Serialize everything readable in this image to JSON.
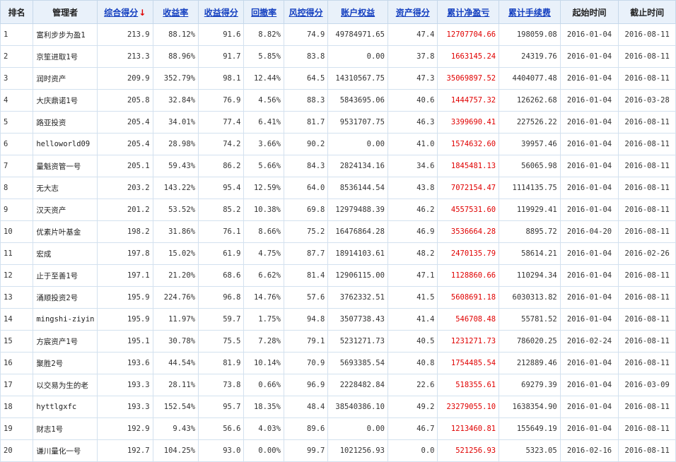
{
  "header": {
    "rank": "排名",
    "manager": "管理者",
    "composite_score": "综合得分",
    "sort_arrow": "↓",
    "return_rate": "收益率",
    "return_score": "收益得分",
    "drawdown": "回撤率",
    "risk_score": "风控得分",
    "equity": "账户权益",
    "asset_score": "资产得分",
    "net_pnl": "累计净盈亏",
    "fees": "累计手续费",
    "start_time": "起始时间",
    "end_time": "截止时间"
  },
  "rows": [
    {
      "rank": "1",
      "name": "富利步步为盈1",
      "score": "213.9",
      "ret": "88.12%",
      "ret_score": "91.6",
      "dd": "8.82%",
      "risk": "74.9",
      "equity": "49784971.65",
      "asset": "47.4",
      "pnl": "12707704.66",
      "fee": "198059.08",
      "start": "2016-01-04",
      "end": "2016-08-11"
    },
    {
      "rank": "2",
      "name": "京笙进取1号",
      "score": "213.3",
      "ret": "88.96%",
      "ret_score": "91.7",
      "dd": "5.85%",
      "risk": "83.8",
      "equity": "0.00",
      "asset": "37.8",
      "pnl": "1663145.24",
      "fee": "24319.76",
      "start": "2016-01-04",
      "end": "2016-08-11"
    },
    {
      "rank": "3",
      "name": "润时资产",
      "score": "209.9",
      "ret": "352.79%",
      "ret_score": "98.1",
      "dd": "12.44%",
      "risk": "64.5",
      "equity": "14310567.75",
      "asset": "47.3",
      "pnl": "35069897.52",
      "fee": "4404077.48",
      "start": "2016-01-04",
      "end": "2016-08-11"
    },
    {
      "rank": "4",
      "name": "大庆鼎诺1号",
      "score": "205.8",
      "ret": "32.84%",
      "ret_score": "76.9",
      "dd": "4.56%",
      "risk": "88.3",
      "equity": "5843695.06",
      "asset": "40.6",
      "pnl": "1444757.32",
      "fee": "126262.68",
      "start": "2016-01-04",
      "end": "2016-03-28"
    },
    {
      "rank": "5",
      "name": "路亚投资",
      "score": "205.4",
      "ret": "34.01%",
      "ret_score": "77.4",
      "dd": "6.41%",
      "risk": "81.7",
      "equity": "9531707.75",
      "asset": "46.3",
      "pnl": "3399690.41",
      "fee": "227526.22",
      "start": "2016-01-04",
      "end": "2016-08-11"
    },
    {
      "rank": "6",
      "name": "helloworld09",
      "score": "205.4",
      "ret": "28.98%",
      "ret_score": "74.2",
      "dd": "3.66%",
      "risk": "90.2",
      "equity": "0.00",
      "asset": "41.0",
      "pnl": "1574632.60",
      "fee": "39957.46",
      "start": "2016-01-04",
      "end": "2016-08-11"
    },
    {
      "rank": "7",
      "name": "量魁资管一号",
      "score": "205.1",
      "ret": "59.43%",
      "ret_score": "86.2",
      "dd": "5.66%",
      "risk": "84.3",
      "equity": "2824134.16",
      "asset": "34.6",
      "pnl": "1845481.13",
      "fee": "56065.98",
      "start": "2016-01-04",
      "end": "2016-08-11"
    },
    {
      "rank": "8",
      "name": "无大志",
      "score": "203.2",
      "ret": "143.22%",
      "ret_score": "95.4",
      "dd": "12.59%",
      "risk": "64.0",
      "equity": "8536144.54",
      "asset": "43.8",
      "pnl": "7072154.47",
      "fee": "1114135.75",
      "start": "2016-01-04",
      "end": "2016-08-11"
    },
    {
      "rank": "9",
      "name": "汉天资产",
      "score": "201.2",
      "ret": "53.52%",
      "ret_score": "85.2",
      "dd": "10.38%",
      "risk": "69.8",
      "equity": "12979488.39",
      "asset": "46.2",
      "pnl": "4557531.60",
      "fee": "119929.41",
      "start": "2016-01-04",
      "end": "2016-08-11"
    },
    {
      "rank": "10",
      "name": "优素片叶基金",
      "score": "198.2",
      "ret": "31.86%",
      "ret_score": "76.1",
      "dd": "8.66%",
      "risk": "75.2",
      "equity": "16476864.28",
      "asset": "46.9",
      "pnl": "3536664.28",
      "fee": "8895.72",
      "start": "2016-04-20",
      "end": "2016-08-11"
    },
    {
      "rank": "11",
      "name": "宏成",
      "score": "197.8",
      "ret": "15.02%",
      "ret_score": "61.9",
      "dd": "4.75%",
      "risk": "87.7",
      "equity": "18914103.61",
      "asset": "48.2",
      "pnl": "2470135.79",
      "fee": "58614.21",
      "start": "2016-01-04",
      "end": "2016-02-26"
    },
    {
      "rank": "12",
      "name": "止于至善1号",
      "score": "197.1",
      "ret": "21.20%",
      "ret_score": "68.6",
      "dd": "6.62%",
      "risk": "81.4",
      "equity": "12906115.00",
      "asset": "47.1",
      "pnl": "1128860.66",
      "fee": "110294.34",
      "start": "2016-01-04",
      "end": "2016-08-11"
    },
    {
      "rank": "13",
      "name": "涌顺投资2号",
      "score": "195.9",
      "ret": "224.76%",
      "ret_score": "96.8",
      "dd": "14.76%",
      "risk": "57.6",
      "equity": "3762332.51",
      "asset": "41.5",
      "pnl": "5608691.18",
      "fee": "6030313.82",
      "start": "2016-01-04",
      "end": "2016-08-11"
    },
    {
      "rank": "14",
      "name": "mingshi-ziyin",
      "score": "195.9",
      "ret": "11.97%",
      "ret_score": "59.7",
      "dd": "1.75%",
      "risk": "94.8",
      "equity": "3507738.43",
      "asset": "41.4",
      "pnl": "546708.48",
      "fee": "55781.52",
      "start": "2016-01-04",
      "end": "2016-08-11"
    },
    {
      "rank": "15",
      "name": "方宸资产1号",
      "score": "195.1",
      "ret": "30.78%",
      "ret_score": "75.5",
      "dd": "7.28%",
      "risk": "79.1",
      "equity": "5231271.73",
      "asset": "40.5",
      "pnl": "1231271.73",
      "fee": "786020.25",
      "start": "2016-02-24",
      "end": "2016-08-11"
    },
    {
      "rank": "16",
      "name": "聚胜2号",
      "score": "193.6",
      "ret": "44.54%",
      "ret_score": "81.9",
      "dd": "10.14%",
      "risk": "70.9",
      "equity": "5693385.54",
      "asset": "40.8",
      "pnl": "1754485.54",
      "fee": "212889.46",
      "start": "2016-01-04",
      "end": "2016-08-11"
    },
    {
      "rank": "17",
      "name": "以交易为生的老",
      "score": "193.3",
      "ret": "28.11%",
      "ret_score": "73.8",
      "dd": "0.66%",
      "risk": "96.9",
      "equity": "2228482.84",
      "asset": "22.6",
      "pnl": "518355.61",
      "fee": "69279.39",
      "start": "2016-01-04",
      "end": "2016-03-09"
    },
    {
      "rank": "18",
      "name": "hyttlgxfc",
      "score": "193.3",
      "ret": "152.54%",
      "ret_score": "95.7",
      "dd": "18.35%",
      "risk": "48.4",
      "equity": "38540386.10",
      "asset": "49.2",
      "pnl": "23279055.10",
      "fee": "1638354.90",
      "start": "2016-01-04",
      "end": "2016-08-11"
    },
    {
      "rank": "19",
      "name": "财志1号",
      "score": "192.9",
      "ret": "9.43%",
      "ret_score": "56.6",
      "dd": "4.03%",
      "risk": "89.6",
      "equity": "0.00",
      "asset": "46.7",
      "pnl": "1213460.81",
      "fee": "155649.19",
      "start": "2016-01-04",
      "end": "2016-08-11"
    },
    {
      "rank": "20",
      "name": "谦川量化一号",
      "score": "192.7",
      "ret": "104.25%",
      "ret_score": "93.0",
      "dd": "0.00%",
      "risk": "99.7",
      "equity": "1021256.93",
      "asset": "0.0",
      "pnl": "521256.93",
      "fee": "5323.05",
      "start": "2016-02-16",
      "end": "2016-08-11"
    }
  ],
  "colors": {
    "header_bg": "#e9f1fa",
    "link": "#1540c0",
    "profit": "#e00000",
    "border": "#d3e1ef"
  }
}
